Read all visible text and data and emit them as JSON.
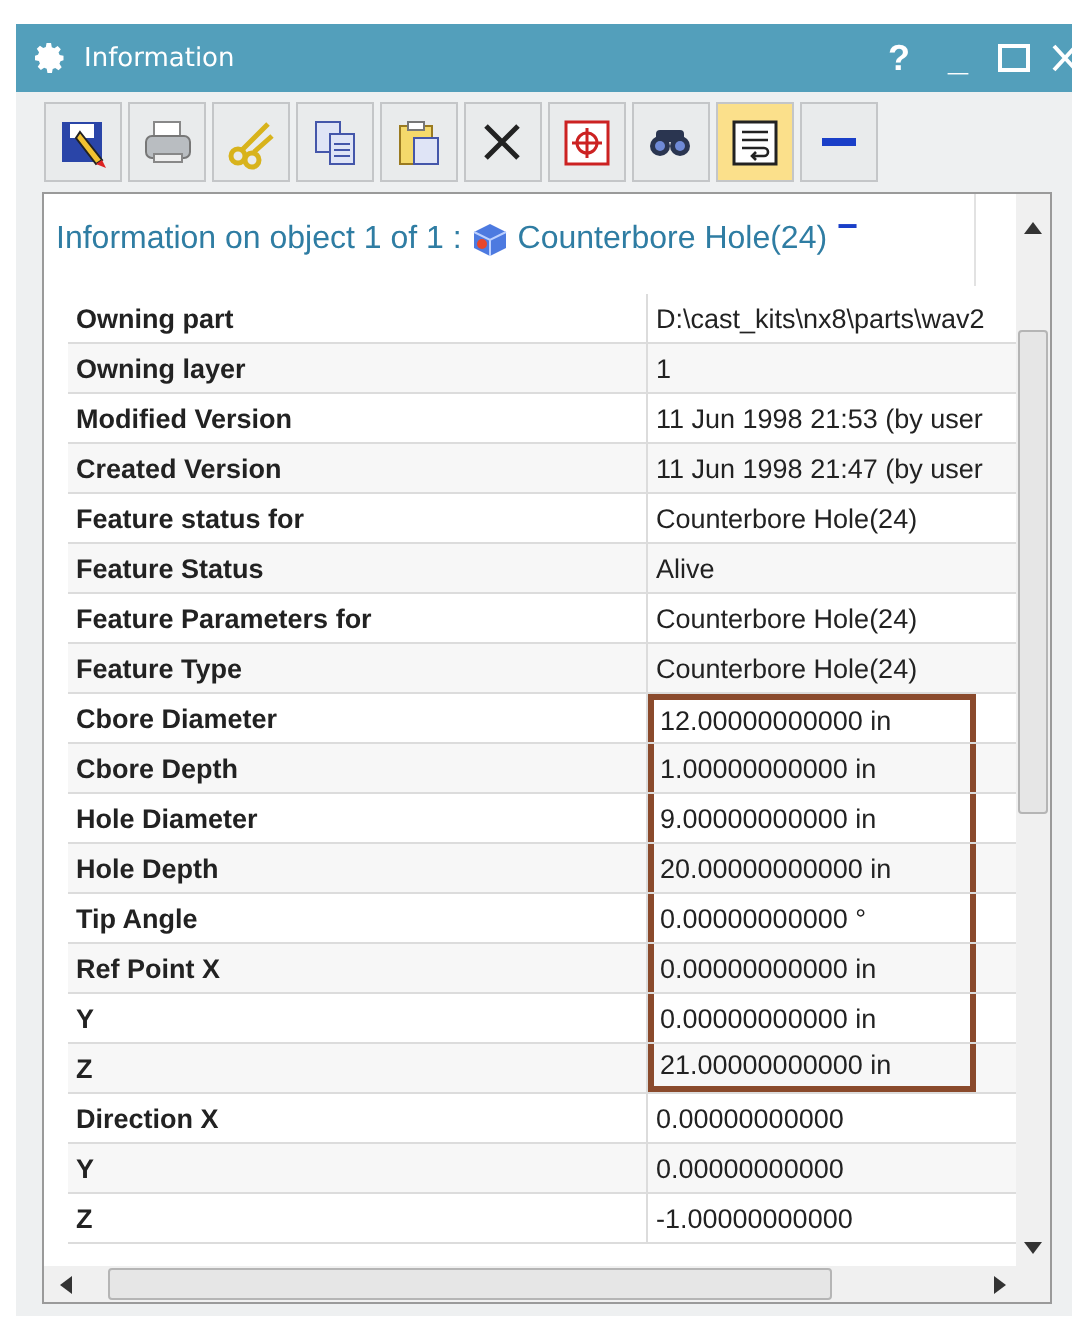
{
  "window": {
    "title": "Information",
    "help": "?",
    "minimize": "_"
  },
  "toolbar": [
    {
      "kind": "save",
      "selected": false
    },
    {
      "kind": "print",
      "selected": false
    },
    {
      "kind": "cut",
      "selected": false
    },
    {
      "kind": "copy",
      "selected": false
    },
    {
      "kind": "paste",
      "selected": false
    },
    {
      "kind": "delete",
      "selected": false
    },
    {
      "kind": "target",
      "selected": false
    },
    {
      "kind": "find",
      "selected": false
    },
    {
      "kind": "wrap",
      "selected": true
    },
    {
      "kind": "collapse",
      "selected": false
    }
  ],
  "header": {
    "text": "Information on object 1 of 1 :",
    "object": "Counterbore Hole(24)",
    "collapse": "−"
  },
  "table": {
    "rows": [
      {
        "label": "Owning part",
        "value": "D:\\cast_kits\\nx8\\parts\\wav2",
        "highlighted": false
      },
      {
        "label": "Owning layer",
        "value": "1",
        "highlighted": false
      },
      {
        "label": "Modified Version",
        "value": "11 Jun 1998 21:53 (by user",
        "highlighted": false
      },
      {
        "label": "Created Version",
        "value": "11 Jun 1998 21:47 (by user",
        "highlighted": false
      },
      {
        "label": "Feature status for",
        "value": "Counterbore Hole(24)",
        "highlighted": false
      },
      {
        "label": "Feature Status",
        "value": "Alive",
        "highlighted": false
      },
      {
        "label": "Feature Parameters for",
        "value": "Counterbore Hole(24)",
        "highlighted": false
      },
      {
        "label": "Feature Type",
        "value": "Counterbore Hole(24)",
        "highlighted": false
      },
      {
        "label": "Cbore Diameter",
        "value": "12.00000000000 in",
        "highlighted": true
      },
      {
        "label": "Cbore Depth",
        "value": "1.00000000000 in",
        "highlighted": true
      },
      {
        "label": "Hole Diameter",
        "value": "9.00000000000 in",
        "highlighted": true
      },
      {
        "label": "Hole Depth",
        "value": "20.00000000000 in",
        "highlighted": true
      },
      {
        "label": "Tip Angle",
        "value": "0.00000000000 °",
        "highlighted": true
      },
      {
        "label": "Ref Point X",
        "value": "0.00000000000 in",
        "highlighted": true
      },
      {
        "label": "Y",
        "value": "0.00000000000 in",
        "highlighted": true
      },
      {
        "label": "Z",
        "value": "21.00000000000 in",
        "highlighted": true
      },
      {
        "label": "Direction X",
        "value": "0.00000000000",
        "highlighted": false
      },
      {
        "label": "Y",
        "value": "0.00000000000",
        "highlighted": false
      },
      {
        "label": "Z",
        "value": "-1.00000000000",
        "highlighted": false
      }
    ]
  }
}
